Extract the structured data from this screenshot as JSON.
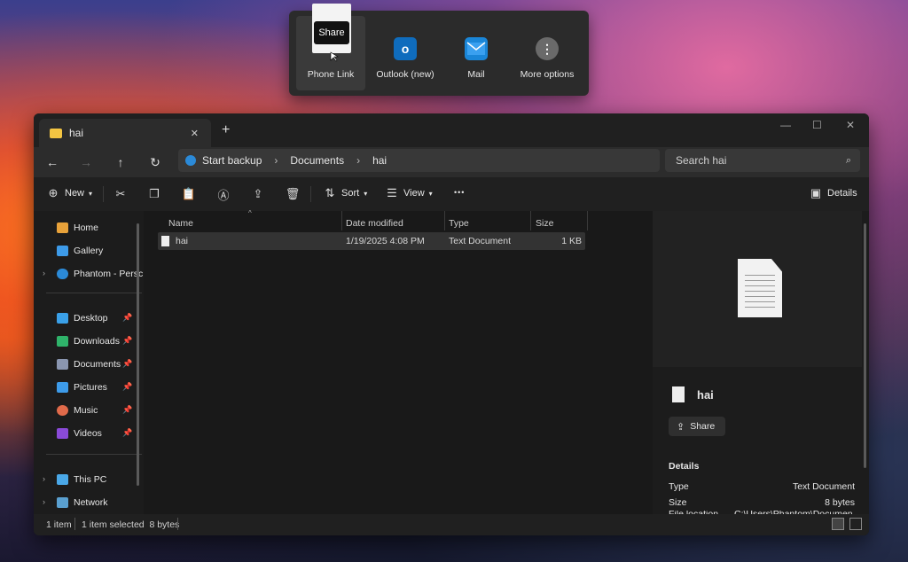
{
  "share_popup": {
    "tooltip": "Share",
    "targets": [
      {
        "label": "Phone Link",
        "icon": "phone-link-icon"
      },
      {
        "label": "Outlook (new)",
        "icon": "outlook-icon"
      },
      {
        "label": "Mail",
        "icon": "mail-icon"
      },
      {
        "label": "More options",
        "icon": "more-options-icon"
      }
    ]
  },
  "window": {
    "tab_title": "hai",
    "new_tab": "+",
    "controls": {
      "minimize": "—",
      "maximize": "☐",
      "close": "✕"
    }
  },
  "address": {
    "crumbs": [
      "Start backup",
      "Documents",
      "hai"
    ],
    "separator": "›"
  },
  "search": {
    "placeholder": "Search hai"
  },
  "toolbar": {
    "new_label": "New",
    "sort_label": "Sort",
    "view_label": "View",
    "more": "•••",
    "details_label": "Details"
  },
  "sidebar": {
    "items": [
      {
        "label": "Home"
      },
      {
        "label": "Gallery"
      },
      {
        "label": "Phantom - Persc"
      },
      {
        "label": "Desktop"
      },
      {
        "label": "Downloads"
      },
      {
        "label": "Documents"
      },
      {
        "label": "Pictures"
      },
      {
        "label": "Music"
      },
      {
        "label": "Videos"
      },
      {
        "label": "This PC"
      },
      {
        "label": "Network"
      }
    ]
  },
  "filelist": {
    "columns": [
      "Name",
      "Date modified",
      "Type",
      "Size"
    ],
    "rows": [
      {
        "name": "hai",
        "date": "1/19/2025 4:08 PM",
        "type": "Text Document",
        "size": "1 KB"
      }
    ]
  },
  "details": {
    "name": "hai",
    "share_label": "Share",
    "section_title": "Details",
    "rows": [
      {
        "key": "Type",
        "value": "Text Document"
      },
      {
        "key": "Size",
        "value": "8 bytes"
      },
      {
        "key": "File location",
        "value": "C:\\Users\\Phantom\\Documen"
      }
    ]
  },
  "status": {
    "items": "1 item",
    "selected": "1 item selected  8 bytes"
  },
  "colors": {
    "accent": "#0078d4",
    "folder": "#f4c542",
    "window_bg": "#191919"
  }
}
